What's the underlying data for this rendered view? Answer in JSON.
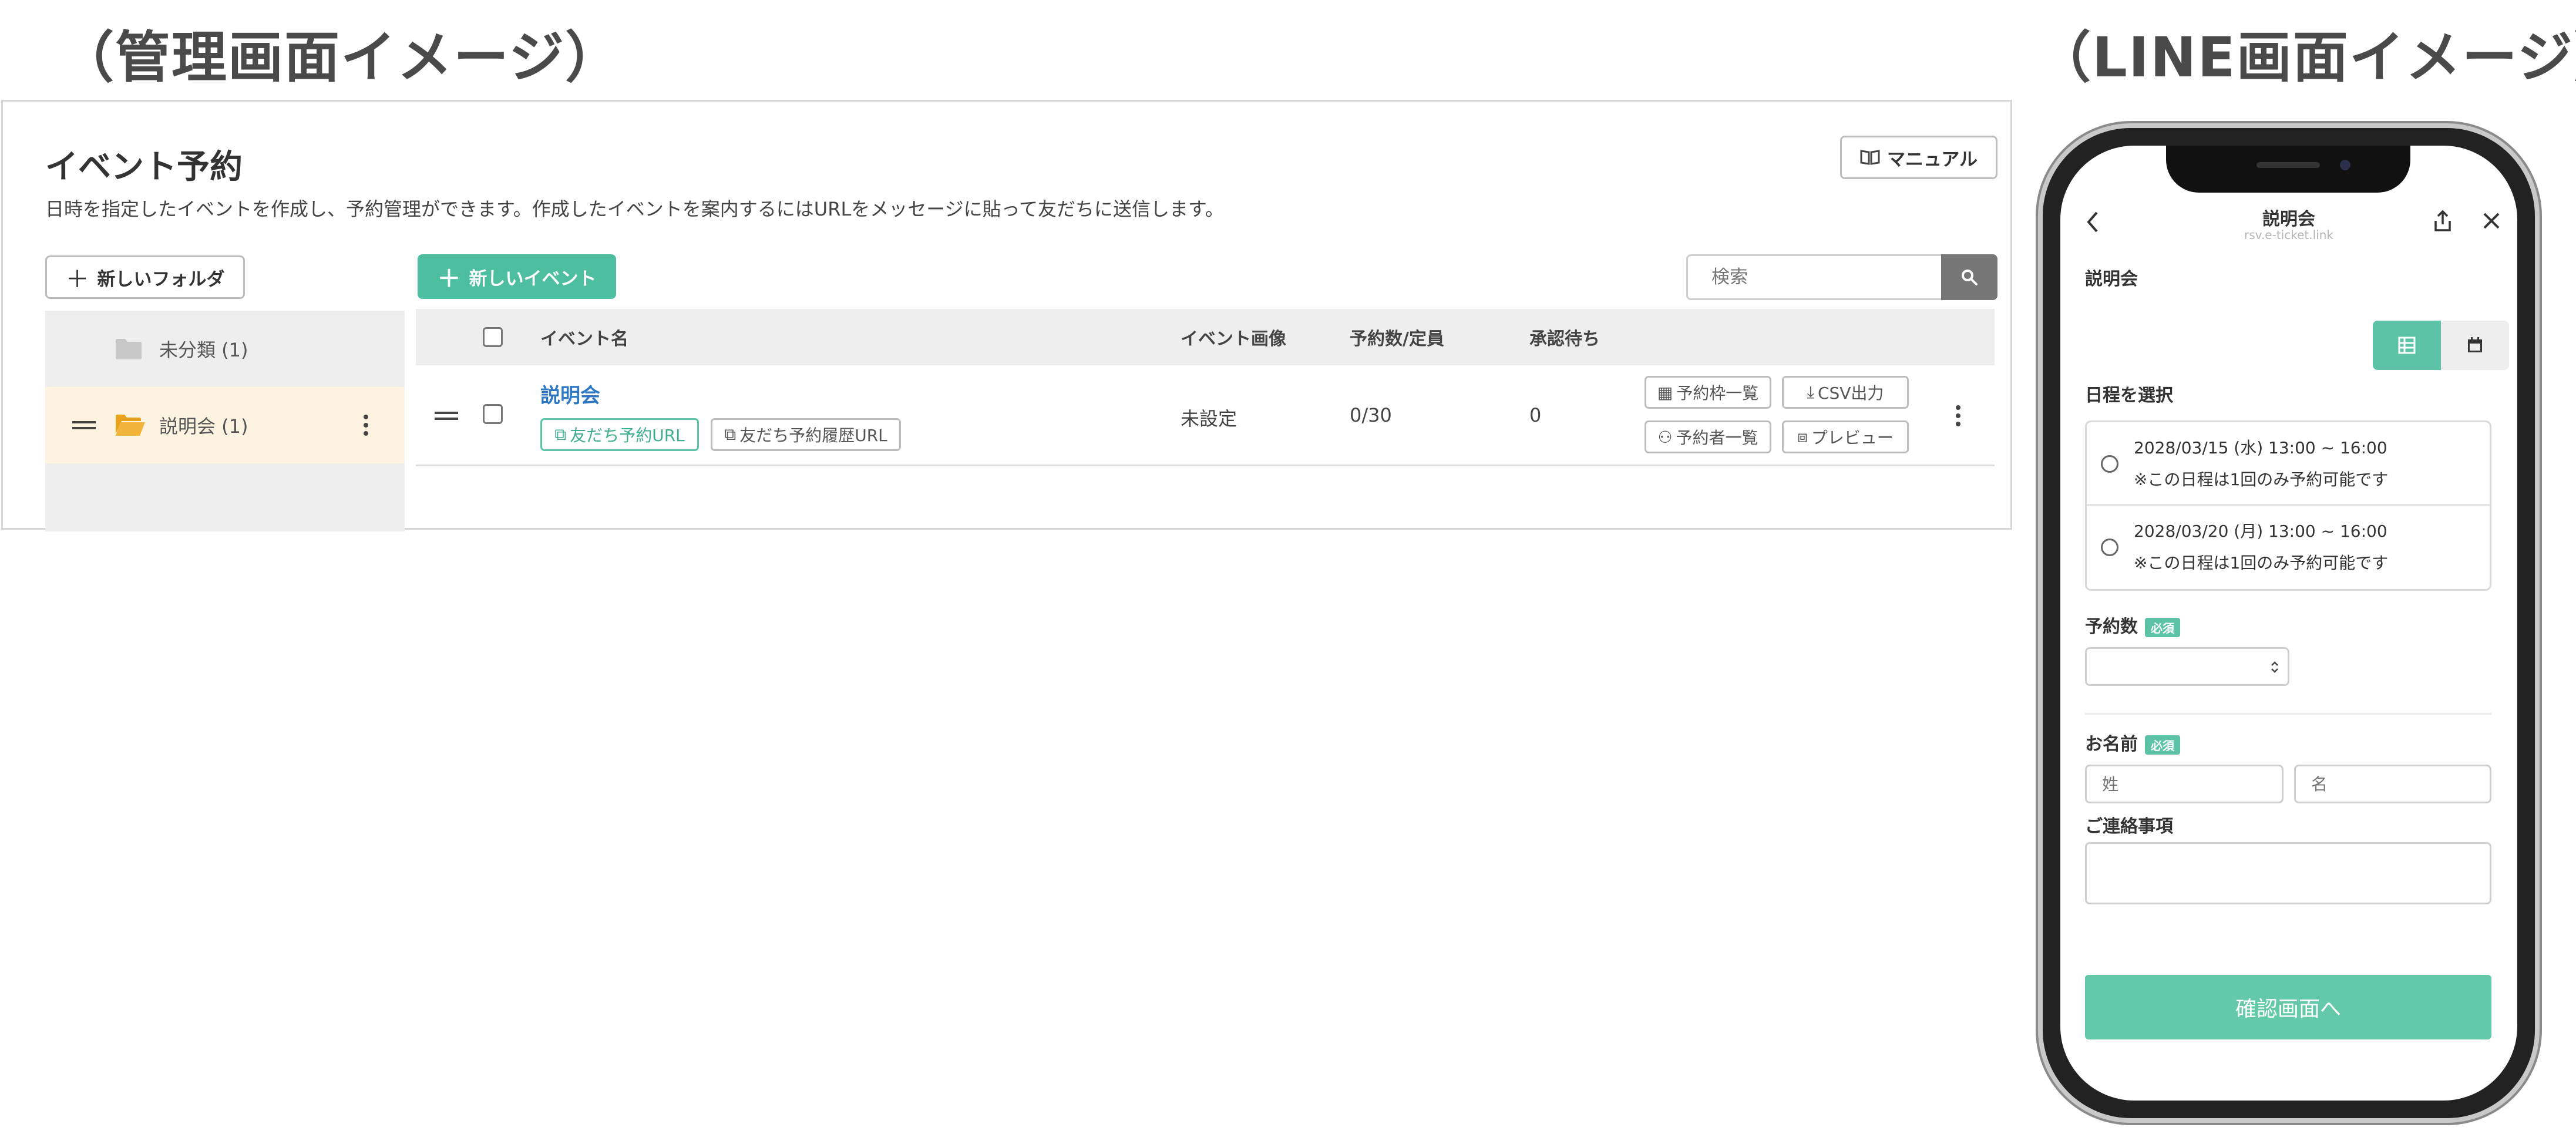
{
  "headings": {
    "admin": "（管理画面イメージ）",
    "line": "（LINE画面イメージ）"
  },
  "admin": {
    "title": "イベント予約",
    "description": "日時を指定したイベントを作成し、予約管理ができます。作成したイベントを案内するにはURLをメッセージに貼って友だちに送信します。",
    "manual_button": "マニュアル",
    "new_folder_button": "新しいフォルダ",
    "new_event_button": "新しいイベント",
    "search": {
      "placeholder": "検索"
    },
    "folders": [
      {
        "label": "未分類 (1)",
        "active": false
      },
      {
        "label": "説明会 (1)",
        "active": true
      }
    ],
    "table": {
      "headers": {
        "name": "イベント名",
        "image": "イベント画像",
        "count": "予約数/定員",
        "pending": "承認待ち"
      },
      "rows": [
        {
          "name": "説明会",
          "friend_url": "友だち予約URL",
          "history_url": "友だち予約履歴URL",
          "image": "未設定",
          "count": "0/30",
          "pending": "0",
          "actions": {
            "slots": "予約枠一覧",
            "csv": "CSV出力",
            "reservers": "予約者一覧",
            "preview": "プレビュー"
          }
        }
      ]
    }
  },
  "line": {
    "header_title": "説明会",
    "header_url": "rsv.e-ticket.link",
    "event_name": "説明会",
    "select_date_label": "日程を選択",
    "dates": [
      {
        "date": "2028/03/15 (水) 13:00 ~ 16:00",
        "note": "※この日程は1回のみ予約可能です"
      },
      {
        "date": "2028/03/20 (月) 13:00 ~ 16:00",
        "note": "※この日程は1回のみ予約可能です"
      }
    ],
    "reservation_count_label": "予約数",
    "required_badge": "必須",
    "name_label": "お名前",
    "last_name_placeholder": "姓",
    "first_name_placeholder": "名",
    "notes_label": "ご連絡事項",
    "confirm_button": "確認画面へ",
    "colors": {
      "accent": "#5cc3a6",
      "confirm_button": "#63c9a8"
    }
  }
}
